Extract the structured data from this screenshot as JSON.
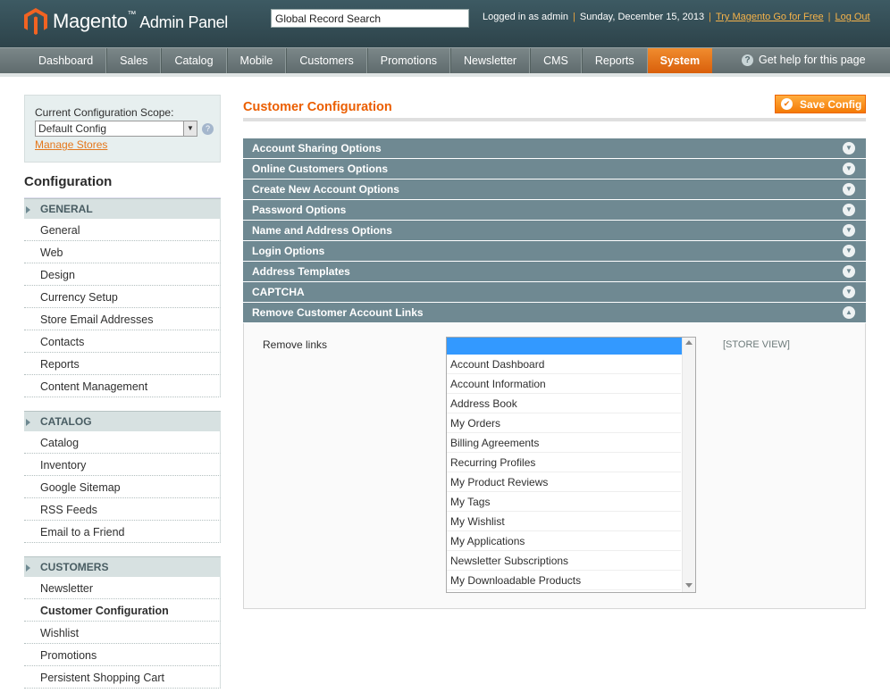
{
  "header": {
    "logo_text": "Magento",
    "logo_tm": "™",
    "logo_sub": "Admin Panel",
    "search_value": "Global Record Search",
    "logged_in": "Logged in as admin",
    "date": "Sunday, December 15, 2013",
    "try_link": "Try Magento Go for Free",
    "logout": "Log Out",
    "separator": "|"
  },
  "nav": {
    "items": [
      "Dashboard",
      "Sales",
      "Catalog",
      "Mobile",
      "Customers",
      "Promotions",
      "Newsletter",
      "CMS",
      "Reports",
      "System"
    ],
    "help": "Get help for this page"
  },
  "sidebar": {
    "scope_label": "Current Configuration Scope:",
    "scope_value": "Default Config",
    "manage_stores": "Manage Stores",
    "title": "Configuration",
    "groups": [
      {
        "label": "GENERAL",
        "items": [
          "General",
          "Web",
          "Design",
          "Currency Setup",
          "Store Email Addresses",
          "Contacts",
          "Reports",
          "Content Management"
        ]
      },
      {
        "label": "CATALOG",
        "items": [
          "Catalog",
          "Inventory",
          "Google Sitemap",
          "RSS Feeds",
          "Email to a Friend"
        ]
      },
      {
        "label": "CUSTOMERS",
        "items": [
          "Newsletter",
          "Customer Configuration",
          "Wishlist",
          "Promotions",
          "Persistent Shopping Cart"
        ]
      }
    ],
    "selected": "Customer Configuration"
  },
  "main": {
    "title": "Customer Configuration",
    "save_label": "Save Config",
    "sections": [
      "Account Sharing Options",
      "Online Customers Options",
      "Create New Account Options",
      "Password Options",
      "Name and Address Options",
      "Login Options",
      "Address Templates",
      "CAPTCHA",
      "Remove Customer Account Links"
    ],
    "remove_links": {
      "label": "Remove links",
      "scope": "[STORE VIEW]",
      "options": [
        "Account Dashboard",
        "Account Information",
        "Address Book",
        "My Orders",
        "Billing Agreements",
        "Recurring Profiles",
        "My Product Reviews",
        "My Tags",
        "My Wishlist",
        "My Applications",
        "Newsletter Subscriptions",
        "My Downloadable Products"
      ]
    }
  },
  "colors": {
    "accent": "#eb5e00",
    "header": "#3d5a63",
    "section": "#6f8992"
  }
}
